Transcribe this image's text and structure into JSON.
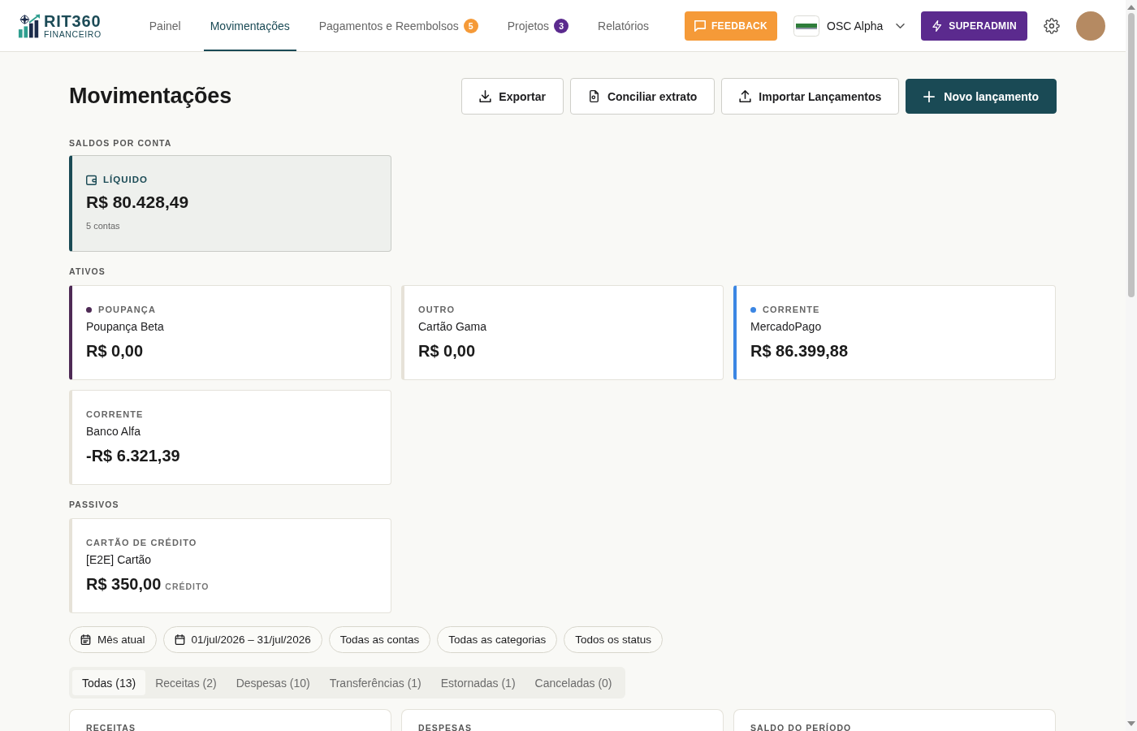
{
  "header": {
    "logo": {
      "name": "RIT360",
      "subtitle": "FINANCEIRO"
    },
    "nav": [
      {
        "label": "Painel",
        "selected": false
      },
      {
        "label": "Movimentações",
        "selected": true
      },
      {
        "label": "Pagamentos e Reembolsos",
        "selected": false,
        "badge": {
          "text": "5",
          "color": "#f59a38"
        }
      },
      {
        "label": "Projetos",
        "selected": false,
        "badge": {
          "text": "3",
          "color": "#5b2a8e"
        }
      },
      {
        "label": "Relatórios",
        "selected": false
      }
    ],
    "feedback_button": "FEEDBACK",
    "organization": "OSC Alpha",
    "superadmin_button": "SUPERADMIN"
  },
  "page": {
    "title": "Movimentações",
    "actions": [
      {
        "label": "Exportar",
        "kind": "download"
      },
      {
        "label": "Conciliar extrato",
        "kind": "reconcile"
      },
      {
        "label": "Importar Lançamentos",
        "kind": "upload"
      },
      {
        "label": "Novo lançamento",
        "kind": "create"
      }
    ]
  },
  "balances": {
    "heading": "SALDOS POR CONTA",
    "net": {
      "label": "LÍQUIDO",
      "amount": "R$ 80.428,49",
      "note": "5 contas"
    }
  },
  "assets": {
    "heading": "ATIVOS",
    "accounts": [
      {
        "type": "POUPANÇA",
        "name": "Poupança Beta",
        "amount": "R$ 0,00",
        "color": "#4e2a55"
      },
      {
        "type": "OUTRO",
        "name": "Cartão Gama",
        "amount": "R$ 0,00"
      },
      {
        "type": "CORRENTE",
        "name": "MercadoPago",
        "amount": "R$ 86.399,88",
        "color": "#3b86e3"
      },
      {
        "type": "CORRENTE",
        "name": "Banco Alfa",
        "amount": "-R$ 6.321,39"
      }
    ]
  },
  "liabilities": {
    "heading": "PASSIVOS",
    "accounts": [
      {
        "type": "CARTÃO DE CRÉDITO",
        "name": "[E2E] Cartão",
        "amount": "R$ 350,00",
        "suffix": "CRÉDITO"
      }
    ]
  },
  "filters": [
    {
      "label": "Mês atual",
      "kind": "preset"
    },
    {
      "label": "01/jul/2026 – 31/jul/2026",
      "kind": "date_range"
    },
    {
      "label": "Todas as contas",
      "kind": "select"
    },
    {
      "label": "Todas as categorias",
      "kind": "select"
    },
    {
      "label": "Todos os status",
      "kind": "select"
    }
  ],
  "tabs": [
    {
      "label": "Todas (13)",
      "selected": true
    },
    {
      "label": "Receitas (2)",
      "selected": false
    },
    {
      "label": "Despesas (10)",
      "selected": false
    },
    {
      "label": "Transferências (1)",
      "selected": false
    },
    {
      "label": "Estornadas (1)",
      "selected": false
    },
    {
      "label": "Canceladas (0)",
      "selected": false
    }
  ],
  "summary_cards": [
    {
      "label": "RECEITAS"
    },
    {
      "label": "DESPESAS"
    },
    {
      "label": "SALDO DO PERÍODO"
    }
  ]
}
